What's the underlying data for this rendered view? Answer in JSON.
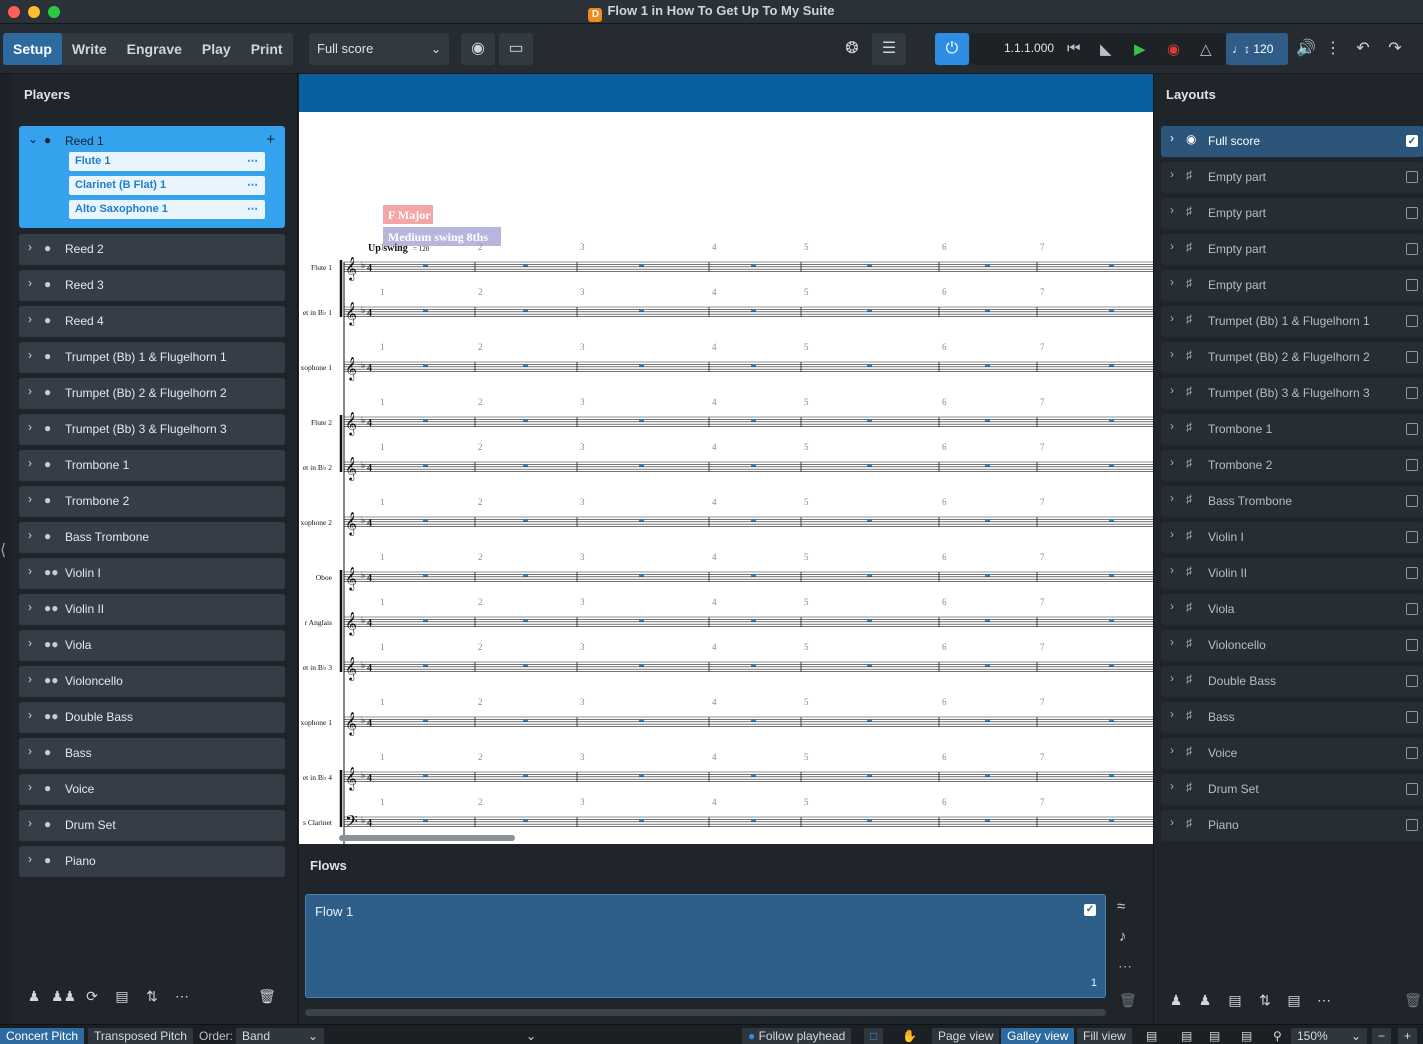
{
  "window": {
    "title": "Flow 1 in How To Get Up To My Suite"
  },
  "toolbar": {
    "modes": [
      "Setup",
      "Write",
      "Engrave",
      "Play",
      "Print"
    ],
    "active_mode": "Setup",
    "layout_select": "Full score",
    "timecode": "1.1.1.000",
    "tempo": "120"
  },
  "players_panel": {
    "title": "Players",
    "expanded_player": {
      "name": "Reed 1",
      "instruments": [
        "Flute 1",
        "Clarinet (B Flat) 1",
        "Alto Saxophone 1"
      ]
    },
    "players": [
      {
        "name": "Reed 2",
        "type": "single"
      },
      {
        "name": "Reed 3",
        "type": "single"
      },
      {
        "name": "Reed 4",
        "type": "single"
      },
      {
        "name": "Trumpet (Bb) 1 & Flugelhorn 1",
        "type": "single"
      },
      {
        "name": "Trumpet (Bb) 2 & Flugelhorn 2",
        "type": "single"
      },
      {
        "name": "Trumpet (Bb) 3 & Flugelhorn 3",
        "type": "single"
      },
      {
        "name": "Trombone 1",
        "type": "single"
      },
      {
        "name": "Trombone 2",
        "type": "single"
      },
      {
        "name": "Bass Trombone",
        "type": "single"
      },
      {
        "name": "Violin I",
        "type": "section"
      },
      {
        "name": "Violin II",
        "type": "section"
      },
      {
        "name": "Viola",
        "type": "section"
      },
      {
        "name": "Violoncello",
        "type": "section"
      },
      {
        "name": "Double Bass",
        "type": "section"
      },
      {
        "name": "Bass",
        "type": "single"
      },
      {
        "name": "Voice",
        "type": "single"
      },
      {
        "name": "Drum Set",
        "type": "single"
      },
      {
        "name": "Piano",
        "type": "single"
      }
    ]
  },
  "score": {
    "key_signature_label": "F Major",
    "playback_label": "Medium swing 8ths",
    "tempo_marking": "Up swing",
    "tempo_value": "= 120",
    "bar_numbers": [
      "1",
      "2",
      "3",
      "4",
      "5",
      "6",
      "7"
    ],
    "staff_labels": [
      "Flute 1",
      "et in B♭ 1",
      "xophone 1",
      "Flute 2",
      "et in B♭ 2",
      "xophone 2",
      "Oboe",
      "r Anglais",
      "et in B♭ 3",
      "xophone 1",
      "et in B♭ 4",
      "s Clarinet"
    ]
  },
  "flows_panel": {
    "title": "Flows",
    "flows": [
      {
        "name": "Flow 1",
        "number": "1"
      }
    ]
  },
  "layouts_panel": {
    "title": "Layouts",
    "layouts": [
      {
        "name": "Full score",
        "checked": true,
        "type": "score"
      },
      {
        "name": "Empty part",
        "checked": false,
        "type": "part"
      },
      {
        "name": "Empty part",
        "checked": false,
        "type": "part"
      },
      {
        "name": "Empty part",
        "checked": false,
        "type": "part"
      },
      {
        "name": "Empty part",
        "checked": false,
        "type": "part"
      },
      {
        "name": "Trumpet (Bb) 1 & Flugelhorn 1",
        "checked": false,
        "type": "part"
      },
      {
        "name": "Trumpet (Bb) 2 & Flugelhorn 2",
        "checked": false,
        "type": "part"
      },
      {
        "name": "Trumpet (Bb) 3 & Flugelhorn 3",
        "checked": false,
        "type": "part"
      },
      {
        "name": "Trombone 1",
        "checked": false,
        "type": "part"
      },
      {
        "name": "Trombone 2",
        "checked": false,
        "type": "part"
      },
      {
        "name": "Bass Trombone",
        "checked": false,
        "type": "part"
      },
      {
        "name": "Violin I",
        "checked": false,
        "type": "part"
      },
      {
        "name": "Violin II",
        "checked": false,
        "type": "part"
      },
      {
        "name": "Viola",
        "checked": false,
        "type": "part"
      },
      {
        "name": "Violoncello",
        "checked": false,
        "type": "part"
      },
      {
        "name": "Double Bass",
        "checked": false,
        "type": "part"
      },
      {
        "name": "Bass",
        "checked": false,
        "type": "part"
      },
      {
        "name": "Voice",
        "checked": false,
        "type": "part"
      },
      {
        "name": "Drum Set",
        "checked": false,
        "type": "part"
      },
      {
        "name": "Piano",
        "checked": false,
        "type": "part"
      }
    ]
  },
  "statusbar": {
    "concert_pitch": "Concert Pitch",
    "transposed_pitch": "Transposed Pitch",
    "order_label": "Order:",
    "order_value": "Band",
    "follow_playhead": "Follow playhead",
    "page_view": "Page view",
    "galley_view": "Galley view",
    "fill_view": "Fill view",
    "zoom": "150%"
  },
  "colors": {
    "accent": "#2c6aa0",
    "player_selected": "#35a2ee",
    "score_header": "#0a5f9e",
    "key_sig_flag": "#f4a6a6",
    "playback_flag": "#b9b6dd"
  }
}
